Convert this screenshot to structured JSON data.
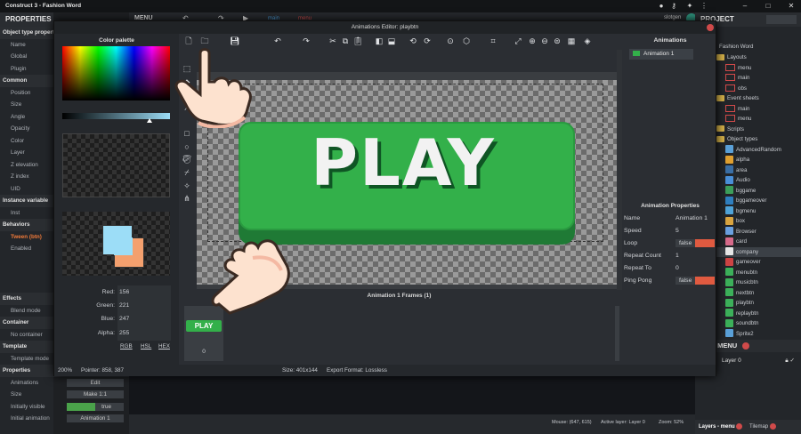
{
  "window": {
    "title": "Construct 3 - Fashion Word",
    "user": "slotgen"
  },
  "menu": {
    "label": "MENU",
    "tabs": [
      "main",
      "menu"
    ]
  },
  "left_panel": {
    "title": "PROPERTIES",
    "rows": [
      {
        "label": "Object type propert",
        "sec": true
      },
      {
        "label": "Name"
      },
      {
        "label": "Global"
      },
      {
        "label": "Plugin"
      },
      {
        "label": "Common",
        "sec": true
      },
      {
        "label": "Position"
      },
      {
        "label": "Size"
      },
      {
        "label": "Angle"
      },
      {
        "label": "Opacity"
      },
      {
        "label": "Color"
      },
      {
        "label": "Layer"
      },
      {
        "label": "Z elevation"
      },
      {
        "label": "Z index"
      },
      {
        "label": "UID"
      },
      {
        "label": "Instance variable",
        "sec": true
      },
      {
        "label": "Inst"
      },
      {
        "label": "Behaviors",
        "sec": true
      },
      {
        "label": "Tween (btn)"
      },
      {
        "label": "Enabled"
      }
    ],
    "rows2": [
      {
        "label": "Effects",
        "sec": true
      },
      {
        "label": "Blend mode"
      },
      {
        "label": "Container",
        "sec": true
      },
      {
        "label": "No container"
      },
      {
        "label": "Template",
        "sec": true
      },
      {
        "label": "Template mode"
      },
      {
        "label": "Properties",
        "sec": true
      },
      {
        "label": "Animations",
        "val": "Edit"
      },
      {
        "label": "Size",
        "val": "Make 1:1"
      },
      {
        "label": "Initially visible",
        "val": "true"
      },
      {
        "label": "Initial animation",
        "val": "Animation 1"
      }
    ]
  },
  "anim_editor": {
    "title": "Animations Editor: playbtn",
    "color_palette": {
      "title": "Color palette",
      "red_label": "Red:",
      "red": "156",
      "green_label": "Green:",
      "green": "221",
      "blue_label": "Blue:",
      "blue": "247",
      "alpha_label": "Alpha:",
      "alpha": "255",
      "modes": [
        "RGB",
        "HSL",
        "HEX"
      ]
    },
    "canvas": {
      "button_text": "PLAY"
    },
    "frames": {
      "title": "Animation 1 Frames (1)",
      "frame_label": "PLAY",
      "frame_index": "0"
    },
    "status": {
      "zoom": "200%",
      "pointer": "Pointer: 858, 387",
      "size": "Size: 401x144",
      "export": "Export Format: Lossless"
    },
    "animations": {
      "title": "Animations",
      "items": [
        "Animation 1"
      ]
    },
    "props": {
      "title": "Animation Properties",
      "rows": [
        {
          "k": "Name",
          "v": "Animation 1"
        },
        {
          "k": "Speed",
          "v": "5"
        },
        {
          "k": "Loop",
          "v": "false",
          "toggle": true
        },
        {
          "k": "Repeat Count",
          "v": "1"
        },
        {
          "k": "Repeat To",
          "v": "0"
        },
        {
          "k": "Ping Pong",
          "v": "false",
          "toggle": true
        }
      ]
    }
  },
  "project": {
    "title": "PROJECT",
    "root": "Fashion Word",
    "items": [
      {
        "label": "Layouts",
        "type": "folder",
        "indent": 1
      },
      {
        "label": "menu",
        "type": "layout",
        "indent": 2
      },
      {
        "label": "main",
        "type": "layout",
        "indent": 2
      },
      {
        "label": "obs",
        "type": "layout",
        "indent": 2
      },
      {
        "label": "Event sheets",
        "type": "folder",
        "indent": 1
      },
      {
        "label": "main",
        "type": "layout",
        "indent": 2
      },
      {
        "label": "menu",
        "type": "layout",
        "indent": 2
      },
      {
        "label": "Scripts",
        "type": "folder",
        "indent": 1
      },
      {
        "label": "Object types",
        "type": "folder",
        "indent": 1
      },
      {
        "label": "AdvancedRandom",
        "type": "obj",
        "color": "#5aa0d8",
        "indent": 2
      },
      {
        "label": "alpha",
        "type": "obj",
        "color": "#e0a030",
        "indent": 2
      },
      {
        "label": "area",
        "type": "obj",
        "color": "#3a6ea5",
        "indent": 2
      },
      {
        "label": "Audio",
        "type": "obj",
        "color": "#4a8fd8",
        "indent": 2
      },
      {
        "label": "bggame",
        "type": "obj",
        "color": "#3c9e5a",
        "indent": 2
      },
      {
        "label": "bggameover",
        "type": "obj",
        "color": "#2f7fbf",
        "indent": 2
      },
      {
        "label": "bgmenu",
        "type": "obj",
        "color": "#4fa3d9",
        "indent": 2
      },
      {
        "label": "box",
        "type": "obj",
        "color": "#d9a440",
        "indent": 2
      },
      {
        "label": "Browser",
        "type": "obj",
        "color": "#6aa0e0",
        "indent": 2
      },
      {
        "label": "card",
        "type": "obj",
        "color": "#d66a8a",
        "indent": 2
      },
      {
        "label": "company",
        "type": "obj",
        "color": "#e6e6e6",
        "indent": 2
      },
      {
        "label": "gameover",
        "type": "obj",
        "color": "#c44",
        "indent": 2
      },
      {
        "label": "menubtn",
        "type": "obj",
        "color": "#3cb05a",
        "indent": 2
      },
      {
        "label": "musicbtn",
        "type": "obj",
        "color": "#3cb05a",
        "indent": 2
      },
      {
        "label": "nextbtn",
        "type": "obj",
        "color": "#3cb05a",
        "indent": 2
      },
      {
        "label": "playbtn",
        "type": "obj",
        "color": "#3cb05a",
        "indent": 2
      },
      {
        "label": "replaybtn",
        "type": "obj",
        "color": "#3cb05a",
        "indent": 2
      },
      {
        "label": "soundbtn",
        "type": "obj",
        "color": "#3cb05a",
        "indent": 2
      },
      {
        "label": "Sprite2",
        "type": "obj",
        "color": "#5aa0d8",
        "indent": 2
      }
    ]
  },
  "layers": {
    "title": "RS - MENU",
    "layer": "Layer 0"
  },
  "bottom": {
    "mouse": "Mouse: (647, 615)",
    "active_layer": "Active layer: Layer 0",
    "zoom": "Zoom: 52%",
    "tab1": "Layers - menu",
    "tab2": "Tilemap"
  }
}
